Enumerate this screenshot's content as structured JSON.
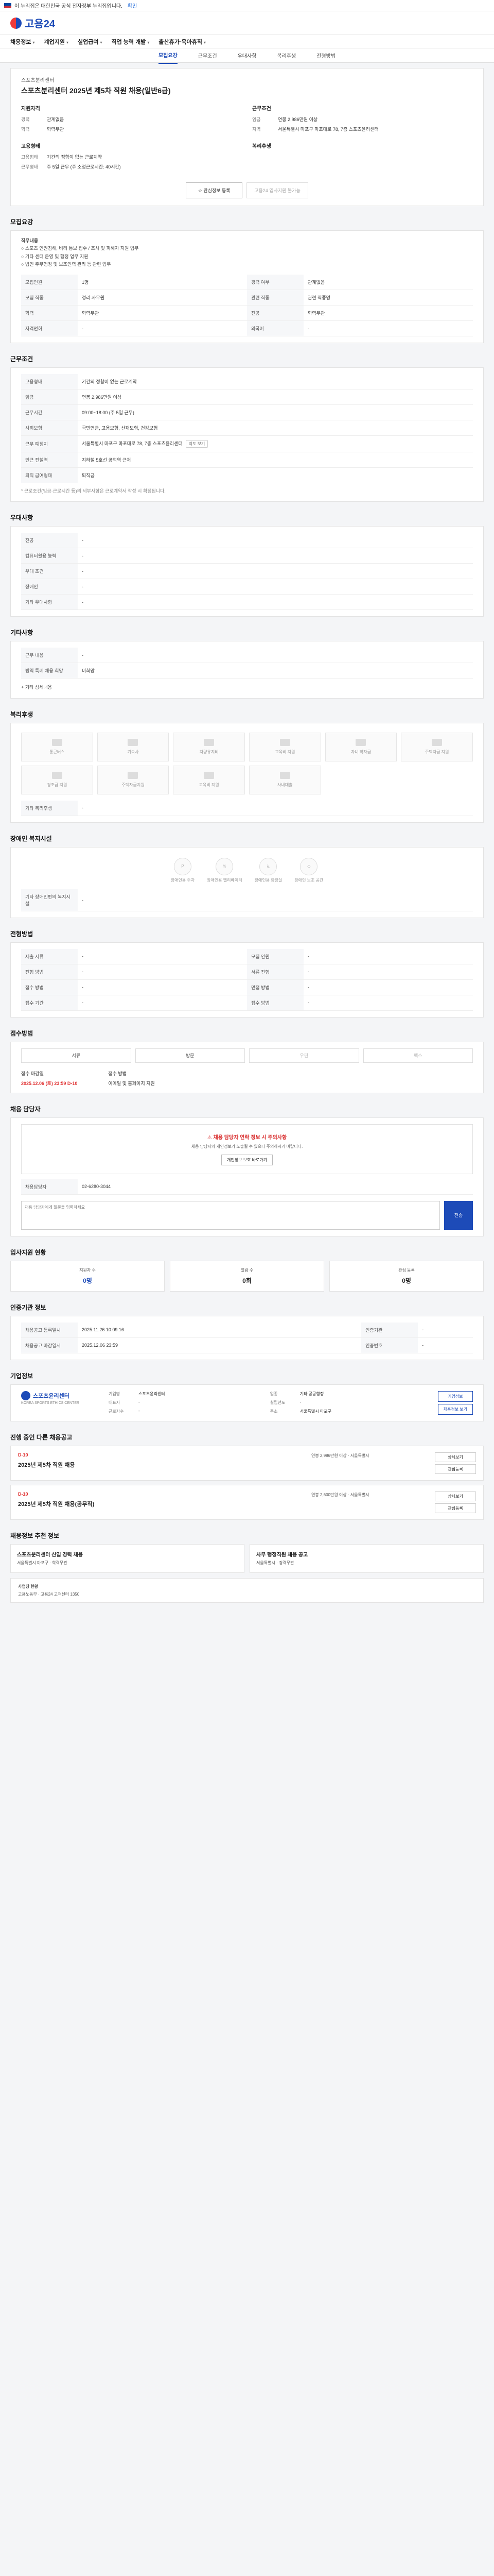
{
  "top": {
    "gov_notice": "이 누리집은 대한민국 공식 전자정부 누리집입니다.",
    "link": "확인"
  },
  "brand": {
    "name": "고용24"
  },
  "gnb": [
    "채용정보",
    "계업지원",
    "실업급여",
    "직업 능력 개발",
    "출산휴가·육아휴직"
  ],
  "tabs": [
    "모집요강",
    "근무조건",
    "우대사항",
    "복리후생",
    "전형방법"
  ],
  "job": {
    "company": "스포츠분리센터",
    "title": "스포츠분리센터 2025년 제5차 직원 채용(일반6급)",
    "left_head": "지원자격",
    "left_kv": [
      [
        "경력",
        "관계없음"
      ],
      [
        "학력",
        "학력무관"
      ]
    ],
    "right_head": "근무조건",
    "right_kv": [
      [
        "임금",
        "연봉 2,986만원 이상"
      ],
      [
        "지역",
        "서울특별시 마포구 마포대로 78, 7층 스포츠윤리센터"
      ]
    ],
    "left2_head": "고용형태",
    "left2_kv": [
      [
        "고용형태",
        "기간의 정함이 없는 근로계약"
      ],
      [
        "근무형태",
        "주 5일 근무 (주 소정근로시간: 40시간)"
      ]
    ],
    "right2_head": "복리후생",
    "btn_apply": "관심정보 등록",
    "btn_disabled": "고용24 입사지원 불가능"
  },
  "sections": {
    "recruit": "모집요강",
    "work": "근무조건",
    "prefer": "우대사항",
    "etc": "기타사항",
    "welfare": "복리후생",
    "disabled": "장애인 복지시설",
    "screen": "전형방법",
    "method": "접수방법",
    "contact": "채용 담당자",
    "stats": "입사지원 현황",
    "info": "인증기관 정보",
    "corp": "기업정보",
    "other": "진행 중인 다른 채용공고",
    "recommend": "채용정보 추천 정보"
  },
  "recruit_note": [
    "직무내용",
    "○ 스포츠 인권침해, 비리 통보 접수 / 조사 및 피해자 지원 업무",
    "○ 기타 센터 운영 및 행정 업무 지원",
    "○ 법인 주무행정 및 보조인력 관리 등 관련 업무"
  ],
  "recruit_table": [
    [
      "모집인원",
      "1명",
      "경력 여부",
      "관계없음"
    ],
    [
      "모집 직종",
      "경리 사무원",
      "관련 직종",
      "관련 직종명"
    ],
    [
      "학력",
      "학력무관",
      "전공",
      "학력무관"
    ],
    [
      "자격면허",
      "-",
      "외국어",
      "-"
    ]
  ],
  "work_table": [
    [
      "고용형태",
      "기간의 정함이 없는 근로계약"
    ],
    [
      "임금",
      "연봉 2,986만원 이상"
    ],
    [
      "근무시간",
      "09:00~18:00 (주 5일 근무)"
    ],
    [
      "사회보험",
      "국민연금, 고용보험, 산재보험, 건강보험"
    ],
    [
      "근무 예정지",
      "서울특별시 마포구 마포대로 78, 7층 스포츠윤리센터"
    ],
    [
      "인근 전철역",
      "지하철 5호선 공덕역 근처"
    ],
    [
      "퇴직 급여형태",
      "퇴직금"
    ]
  ],
  "work_footnote": "* 근로조건(임금·근로시간 등)의 세부사항은 근로계약서 작성 시 확정됩니다.",
  "prefer_table": [
    [
      "전공",
      "-"
    ],
    [
      "컴퓨터활용 능력",
      "-"
    ],
    [
      "우대 조건",
      "-"
    ],
    [
      "장애인",
      "-"
    ],
    [
      "기타 우대사항",
      "-"
    ]
  ],
  "etc_table": [
    [
      "근무 내용",
      "-"
    ],
    [
      "병역 특례 채용 희망",
      "미희망"
    ]
  ],
  "etc_more": "+ 기타 상세내용",
  "welfare_items": [
    "통근버스",
    "기숙사",
    "차량유지비",
    "교육비 지원",
    "자녀 학자금",
    "주택자금 지원",
    "경조금 지원",
    "주택자금지원",
    "교육비 지원",
    "사내대출"
  ],
  "welfare_extra": "기타 복리후생",
  "disabled_items": [
    "장애인용 주차",
    "장애인용 엘리베이터",
    "장애인용 화장실",
    "장애인 보조 공간"
  ],
  "disabled_extra": "기타 장애인편의 복지시설",
  "screen_table": [
    [
      "제출 서류",
      "-",
      "모집 인원",
      "-"
    ],
    [
      "전형 방법",
      "-",
      "서류 전형",
      "-"
    ],
    [
      "접수 방법",
      "-",
      "면접 방법",
      "-"
    ],
    [
      "접수 기간",
      "-",
      "접수 방법",
      "-"
    ]
  ],
  "method_items": [
    "서류",
    "방문",
    "우편",
    "팩스"
  ],
  "due_label": "접수 마감일",
  "due_value": "2025.12.06 (토) 23:59",
  "due_dday": "D-10",
  "doc_label": "접수 방법",
  "doc_value": "이메일 및 홈페이지 지원",
  "contact_warning": "채용 담당자 연락 정보 시 주의사항",
  "contact_p1": "채용 담당자의 개인정보가 노출될 수 있으니 주의하시기 바랍니다.",
  "contact_btn": "개인정보 보호 바로가기",
  "contact_name": "채용담당자",
  "contact_phone": "02-6280-3044",
  "chat_placeholder": "채용 담당자에게 질문을 입력하세요",
  "chat_send": "전송",
  "stats": [
    [
      "지원자 수",
      "0명"
    ],
    [
      "열람 수",
      "0회"
    ],
    [
      "관심 등록",
      "0명"
    ]
  ],
  "info_table": [
    [
      "채용공고 등록일시",
      "2025.11.26 10:09:16",
      "인증기관",
      "-"
    ],
    [
      "채용공고 마감일시",
      "2025.12.06 23:59",
      "인증번호",
      "-"
    ]
  ],
  "corp": {
    "name": "스포츠윤리센터",
    "eng": "KOREA SPORTS ETHICS CENTER",
    "kv": [
      [
        "기업명",
        "스포츠윤리센터"
      ],
      [
        "업종",
        "기타 공공행정"
      ],
      [
        "대표자",
        "-"
      ],
      [
        "설립년도",
        "-"
      ],
      [
        "근로자수",
        "-"
      ],
      [
        "주소",
        "서울특별시 마포구"
      ]
    ],
    "btn1": "기업정보",
    "btn2": "채용정보 보기"
  },
  "other_jobs": [
    {
      "dday": "D-10",
      "title": "2025년 제5차 직원 채용",
      "info": "연봉 2,986만원 이상 · 서울특별시",
      "btn1": "상세보기",
      "btn2": "관심등록"
    },
    {
      "dday": "D-10",
      "title": "2025년 제5차 직원 채용(공무직)",
      "info": "연봉 2,600만원 이상 · 서울특별시",
      "btn1": "상세보기",
      "btn2": "관심등록"
    }
  ],
  "recommend": [
    {
      "title": "스포츠분리센터 신입 경력 채용",
      "info": "서울특별시 마포구 · 학력무관"
    },
    {
      "title": "사무 행정직원 채용 공고",
      "info": "서울특별시 · 경력무관"
    }
  ],
  "footer_title": "사업장 현황",
  "footer_info": "고용노동부 · 고용24 고객센터 1350"
}
